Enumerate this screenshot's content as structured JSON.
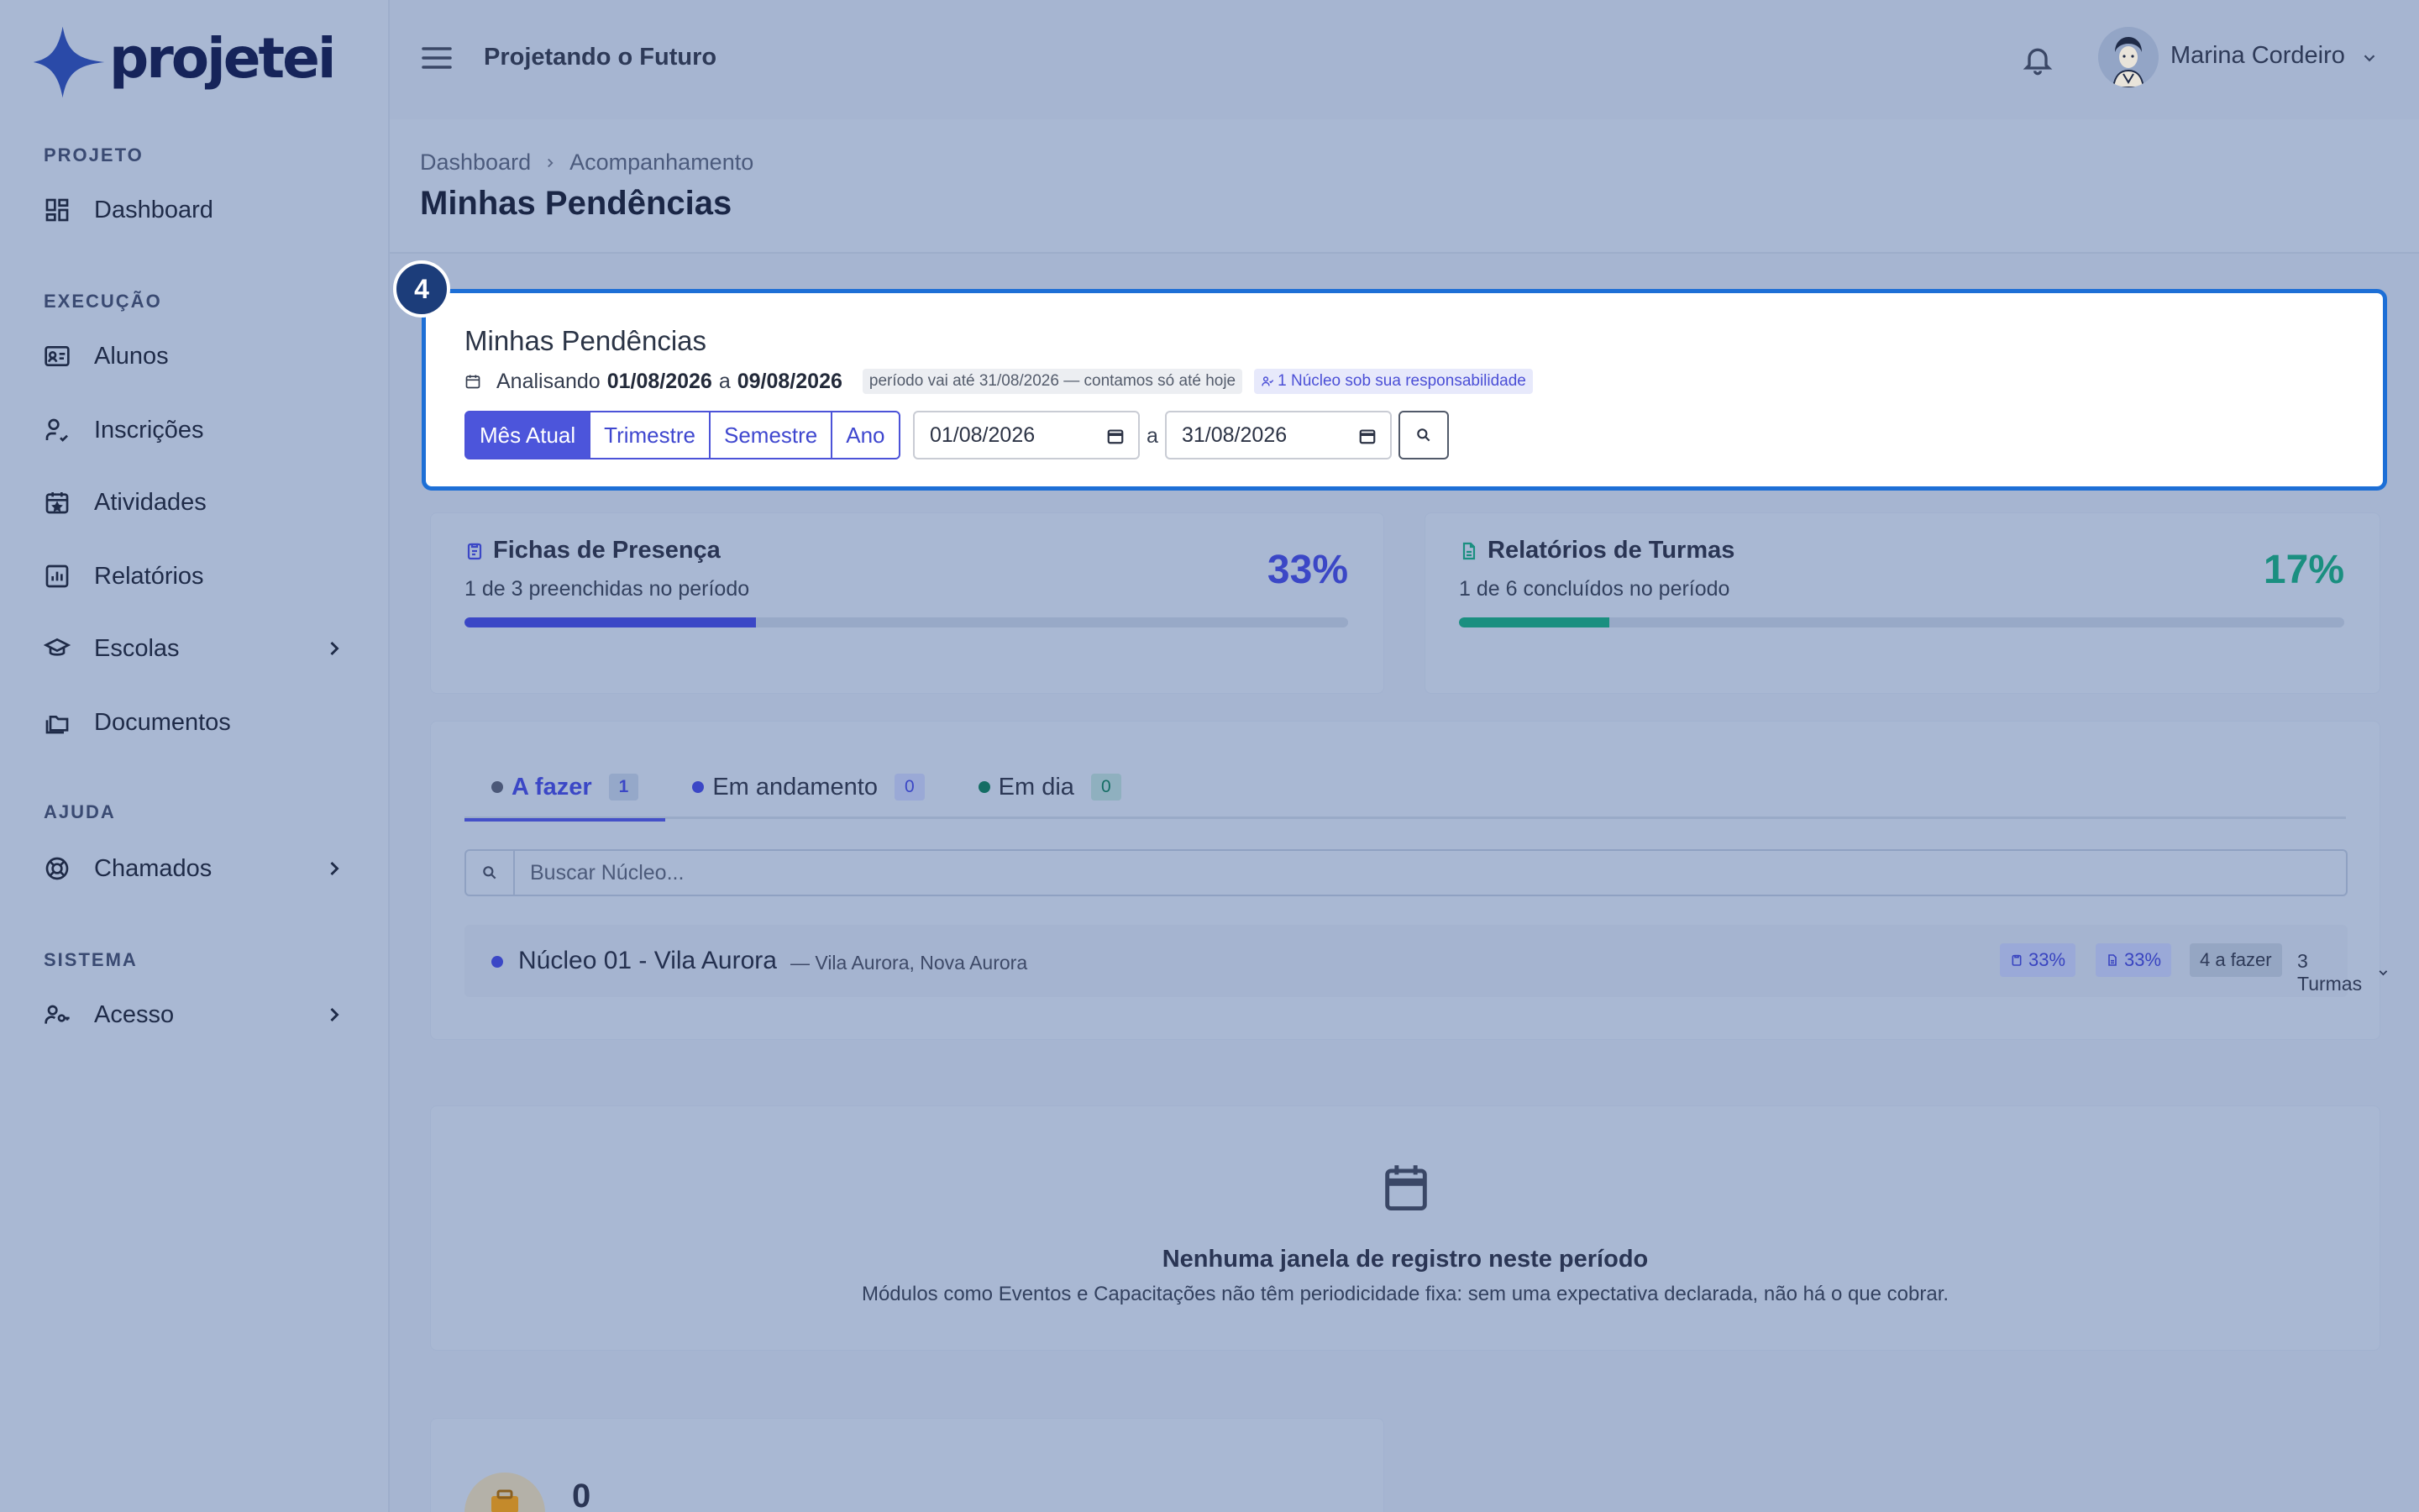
{
  "brand": {
    "name": "projetei"
  },
  "header": {
    "app_title": "Projetando o Futuro",
    "user_name": "Marina Cordeiro"
  },
  "sidebar": {
    "sections": [
      {
        "label": "PROJETO"
      },
      {
        "label": "EXECUÇÃO"
      },
      {
        "label": "AJUDA"
      },
      {
        "label": "SISTEMA"
      }
    ],
    "items": [
      {
        "label": "Dashboard",
        "icon": "dashboard-icon"
      },
      {
        "label": "Alunos",
        "icon": "id-card-icon"
      },
      {
        "label": "Inscrições",
        "icon": "user-check-icon"
      },
      {
        "label": "Atividades",
        "icon": "calendar-star-icon"
      },
      {
        "label": "Relatórios",
        "icon": "bar-chart-icon"
      },
      {
        "label": "Escolas",
        "icon": "school-icon",
        "has_children": true
      },
      {
        "label": "Documentos",
        "icon": "folders-icon"
      },
      {
        "label": "Chamados",
        "icon": "lifebuoy-icon",
        "has_children": true
      },
      {
        "label": "Acesso",
        "icon": "user-key-icon",
        "has_children": true
      }
    ]
  },
  "breadcrumb": {
    "items": [
      "Dashboard",
      "Acompanhamento"
    ]
  },
  "page": {
    "title": "Minhas Pendências"
  },
  "tour": {
    "step": "4"
  },
  "filters": {
    "title": "Minhas Pendências",
    "analyzing_label": "Analisando",
    "start": "01/08/2026",
    "connector": "a",
    "end": "09/08/2026",
    "period_note": "período vai até 31/08/2026 — contamos só até hoje",
    "responsibility_note": "1 Núcleo sob sua responsabilidade",
    "presets": [
      "Mês Atual",
      "Trimestre",
      "Semestre",
      "Ano"
    ],
    "active_preset": "Mês Atual",
    "date_from": "01/08/2026",
    "date_sep": "a",
    "date_to": "31/08/2026"
  },
  "stats": [
    {
      "title": "Fichas de Presença",
      "subtitle": "1 de 3 preenchidas no período",
      "percent_label": "33%",
      "percent": 33,
      "color": "#3b47c6"
    },
    {
      "title": "Relatórios de Turmas",
      "subtitle": "1 de 6 concluídos no período",
      "percent_label": "17%",
      "percent": 17,
      "color": "#1a8f80"
    }
  ],
  "tabs": [
    {
      "label": "A fazer",
      "count": "1",
      "dot_color": "#4b5878"
    },
    {
      "label": "Em andamento",
      "count": "0",
      "dot_color": "#3b47c6"
    },
    {
      "label": "Em dia",
      "count": "0",
      "dot_color": "#146d64"
    }
  ],
  "search": {
    "placeholder": "Buscar Núcleo..."
  },
  "nucleos": [
    {
      "name": "Núcleo 01 - Vila Aurora",
      "location": "— Vila Aurora, Nova Aurora",
      "presence_pct": "33%",
      "report_pct": "33%",
      "todo": "4 a fazer",
      "turmas": "3 Turmas"
    }
  ],
  "empty_state": {
    "title": "Nenhuma janela de registro neste período",
    "subtitle": "Módulos como Eventos e Capacitações não têm periodicidade fixa: sem uma expectativa declarada, não há o que cobrar."
  },
  "bottom_stat": {
    "value": "0"
  }
}
